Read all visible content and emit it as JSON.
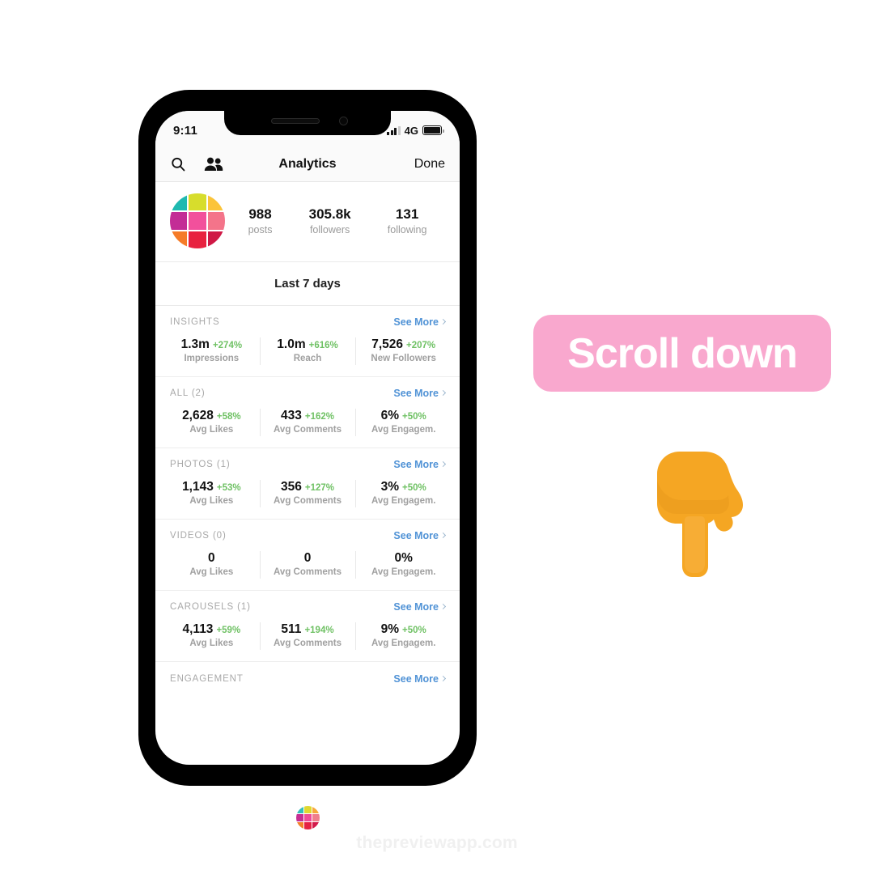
{
  "status_bar": {
    "time": "9:11",
    "network": "4G",
    "signal_icon": "signal-bars-icon",
    "battery_icon": "battery-icon"
  },
  "nav": {
    "search_icon": "search-icon",
    "people_icon": "people-icon",
    "title": "Analytics",
    "done_label": "Done"
  },
  "profile": {
    "avatar_icon": "profile-avatar",
    "avatar_colors": [
      "#1fb9b0",
      "#d7dd2c",
      "#fbc43a",
      "#c32c96",
      "#f2509c",
      "#f4748a",
      "#f57b28",
      "#e8213f",
      "#cf1845"
    ],
    "stats": [
      {
        "value": "988",
        "label": "posts"
      },
      {
        "value": "305.8k",
        "label": "followers"
      },
      {
        "value": "131",
        "label": "following"
      }
    ]
  },
  "range": {
    "label": "Last 7 days"
  },
  "see_more_label": "See More",
  "sections": [
    {
      "title": "INSIGHTS",
      "metrics": [
        {
          "value": "1.3m",
          "delta": "+274%",
          "label": "Impressions"
        },
        {
          "value": "1.0m",
          "delta": "+616%",
          "label": "Reach"
        },
        {
          "value": "7,526",
          "delta": "+207%",
          "label": "New Followers"
        }
      ]
    },
    {
      "title": "ALL (2)",
      "metrics": [
        {
          "value": "2,628",
          "delta": "+58%",
          "label": "Avg Likes"
        },
        {
          "value": "433",
          "delta": "+162%",
          "label": "Avg Comments"
        },
        {
          "value": "6%",
          "delta": "+50%",
          "label": "Avg Engagem."
        }
      ]
    },
    {
      "title": "PHOTOS (1)",
      "metrics": [
        {
          "value": "1,143",
          "delta": "+53%",
          "label": "Avg Likes"
        },
        {
          "value": "356",
          "delta": "+127%",
          "label": "Avg Comments"
        },
        {
          "value": "3%",
          "delta": "+50%",
          "label": "Avg Engagem."
        }
      ]
    },
    {
      "title": "VIDEOS (0)",
      "metrics": [
        {
          "value": "0",
          "delta": "",
          "label": "Avg Likes"
        },
        {
          "value": "0",
          "delta": "",
          "label": "Avg Comments"
        },
        {
          "value": "0%",
          "delta": "",
          "label": "Avg Engagem."
        }
      ]
    },
    {
      "title": "CAROUSELS (1)",
      "metrics": [
        {
          "value": "4,113",
          "delta": "+59%",
          "label": "Avg Likes"
        },
        {
          "value": "511",
          "delta": "+194%",
          "label": "Avg Comments"
        },
        {
          "value": "9%",
          "delta": "+50%",
          "label": "Avg Engagem."
        }
      ]
    },
    {
      "title": "ENGAGEMENT",
      "metrics": []
    }
  ],
  "callout": {
    "text": "Scroll down",
    "background": "#f9a8ce",
    "text_color": "#ffffff"
  },
  "hand": {
    "icon": "pointing-down-hand-icon"
  },
  "footer": {
    "logo_icon": "preview-app-logo",
    "logo_colors": [
      "#35bfb8",
      "#e0d830",
      "#f7a93c",
      "#c62e93",
      "#ef4b97",
      "#f07f8c",
      "#f2812b",
      "#e52244",
      "#d31a4b"
    ],
    "watermark": "thepreviewapp.com"
  },
  "colors": {
    "accent_blue": "#5193d6",
    "positive_green": "#6fc164",
    "muted_gray": "#a0a0a0"
  }
}
